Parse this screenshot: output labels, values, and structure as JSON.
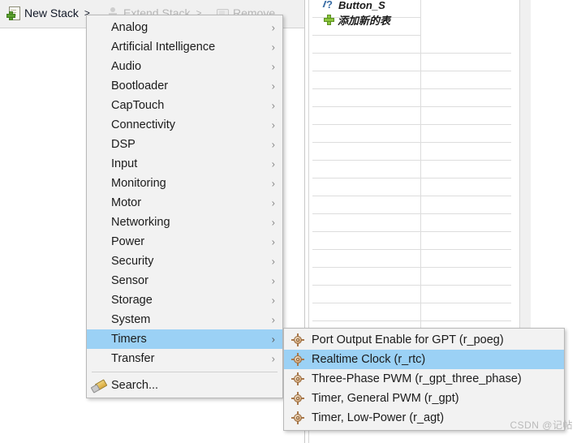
{
  "toolbar": {
    "items": [
      {
        "label": "New Stack",
        "arrow": ">",
        "icon": "new-stack-icon",
        "enabled": true
      },
      {
        "label": "Extend Stack",
        "arrow": ">",
        "icon": "extend-stack-icon",
        "enabled": false
      },
      {
        "label": "Remove",
        "arrow": "",
        "icon": "remove-icon",
        "enabled": false
      }
    ]
  },
  "grid": {
    "rows": [
      {
        "label": "Button_S",
        "icon": "question-mark-icon",
        "partial": true
      },
      {
        "label": "添加新的表",
        "icon": "plus-icon",
        "partial": true
      }
    ]
  },
  "menu": {
    "items": [
      {
        "label": "Analog",
        "chevron": "›",
        "selected": false
      },
      {
        "label": "Artificial Intelligence",
        "chevron": "›",
        "selected": false
      },
      {
        "label": "Audio",
        "chevron": "›",
        "selected": false
      },
      {
        "label": "Bootloader",
        "chevron": "›",
        "selected": false
      },
      {
        "label": "CapTouch",
        "chevron": "›",
        "selected": false
      },
      {
        "label": "Connectivity",
        "chevron": "›",
        "selected": false
      },
      {
        "label": "DSP",
        "chevron": "›",
        "selected": false
      },
      {
        "label": "Input",
        "chevron": "›",
        "selected": false
      },
      {
        "label": "Monitoring",
        "chevron": "›",
        "selected": false
      },
      {
        "label": "Motor",
        "chevron": "›",
        "selected": false
      },
      {
        "label": "Networking",
        "chevron": "›",
        "selected": false
      },
      {
        "label": "Power",
        "chevron": "›",
        "selected": false
      },
      {
        "label": "Security",
        "chevron": "›",
        "selected": false
      },
      {
        "label": "Sensor",
        "chevron": "›",
        "selected": false
      },
      {
        "label": "Storage",
        "chevron": "›",
        "selected": false
      },
      {
        "label": "System",
        "chevron": "›",
        "selected": false
      },
      {
        "label": "Timers",
        "chevron": "›",
        "selected": true
      },
      {
        "label": "Transfer",
        "chevron": "›",
        "selected": false
      }
    ],
    "search": {
      "label": "Search...",
      "icon": "search-icon"
    }
  },
  "submenu": {
    "items": [
      {
        "label": "Port Output Enable for GPT (r_poeg)",
        "icon": "module-icon",
        "selected": false
      },
      {
        "label": "Realtime Clock (r_rtc)",
        "icon": "module-icon",
        "selected": true
      },
      {
        "label": "Three-Phase PWM (r_gpt_three_phase)",
        "icon": "module-icon",
        "selected": false
      },
      {
        "label": "Timer, General PWM (r_gpt)",
        "icon": "module-icon",
        "selected": false
      },
      {
        "label": "Timer, Low-Power (r_agt)",
        "icon": "module-icon",
        "selected": false
      }
    ]
  },
  "watermark": {
    "text": "CSDN @记帖"
  },
  "colors": {
    "selection": "#9bd1f5",
    "menu_bg": "#f2f2f2",
    "menu_border": "#b9b9b9",
    "toolbar_bg": "#f0f0f0"
  }
}
